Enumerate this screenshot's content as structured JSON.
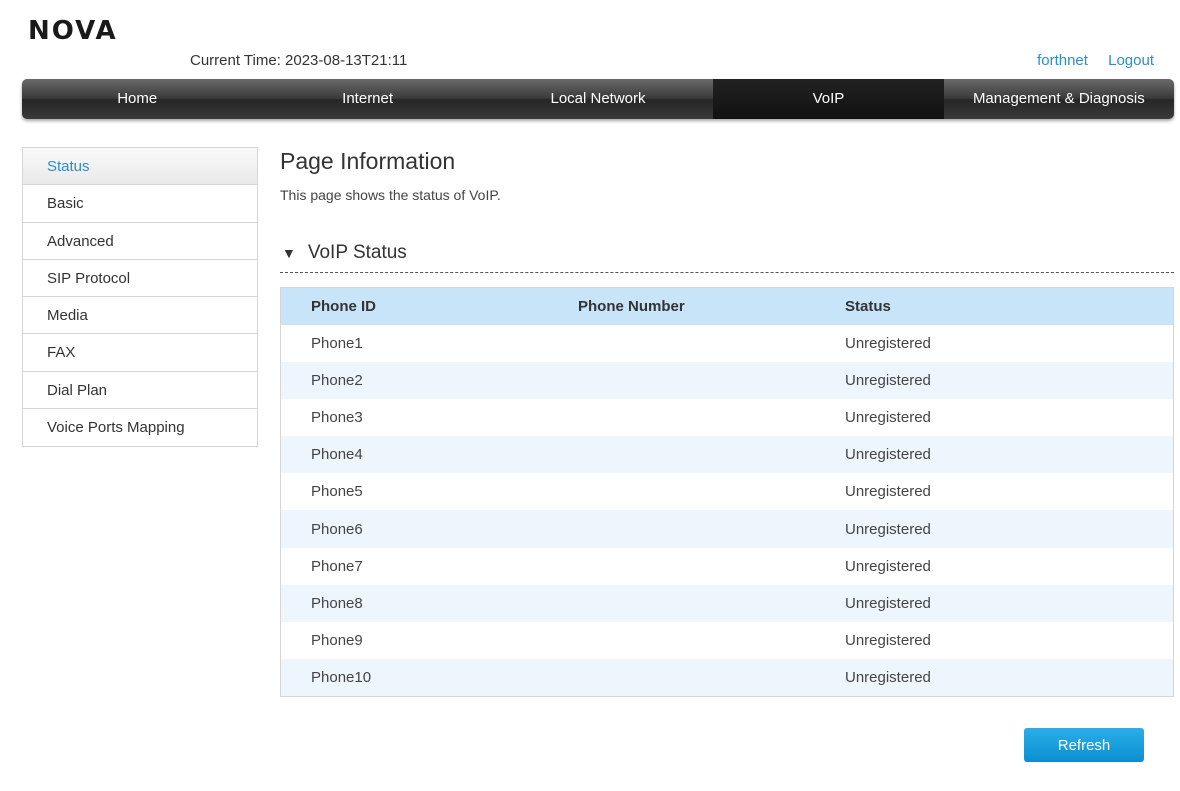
{
  "brand": {
    "logo": "NOVA"
  },
  "header": {
    "current_time_label": "Current Time:",
    "current_time": "2023-08-13T21:11",
    "user_link": "forthnet",
    "logout_link": "Logout"
  },
  "nav": {
    "active": "VoIP",
    "items": [
      "Home",
      "Internet",
      "Local Network",
      "VoIP",
      "Management & Diagnosis"
    ]
  },
  "sidebar": {
    "active": "Status",
    "items": [
      "Status",
      "Basic",
      "Advanced",
      "SIP Protocol",
      "Media",
      "FAX",
      "Dial Plan",
      "Voice Ports Mapping"
    ]
  },
  "main": {
    "title": "Page Information",
    "description": "This page shows the status of VoIP.",
    "section_title": "VoIP Status",
    "table": {
      "headers": [
        "Phone ID",
        "Phone Number",
        "Status"
      ],
      "rows": [
        [
          "Phone1",
          "",
          "Unregistered"
        ],
        [
          "Phone2",
          "",
          "Unregistered"
        ],
        [
          "Phone3",
          "",
          "Unregistered"
        ],
        [
          "Phone4",
          "",
          "Unregistered"
        ],
        [
          "Phone5",
          "",
          "Unregistered"
        ],
        [
          "Phone6",
          "",
          "Unregistered"
        ],
        [
          "Phone7",
          "",
          "Unregistered"
        ],
        [
          "Phone8",
          "",
          "Unregistered"
        ],
        [
          "Phone9",
          "",
          "Unregistered"
        ],
        [
          "Phone10",
          "",
          "Unregistered"
        ]
      ]
    },
    "refresh_label": "Refresh"
  },
  "colors": {
    "accent": "#2a8fc4",
    "header_row": "#c8e4f8",
    "alt_row": "#eef6fd",
    "button": "#1ea0e0"
  },
  "icons": {
    "section_toggle": "triangle-down-icon"
  }
}
